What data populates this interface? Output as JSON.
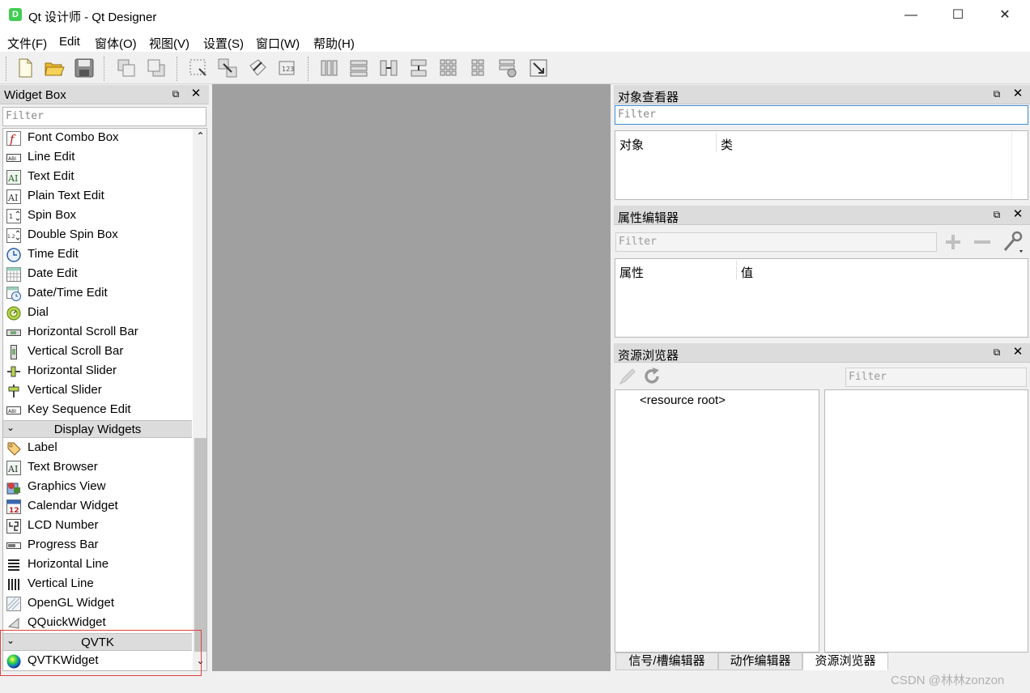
{
  "window": {
    "title": "Qt 设计师 - Qt Designer",
    "app_icon_letter": "D",
    "minimize": "—",
    "maximize": "☐",
    "close": "✕"
  },
  "menu": [
    "文件(F)",
    "Edit",
    "窗体(O)",
    "视图(V)",
    "设置(S)",
    "窗口(W)",
    "帮助(H)"
  ],
  "widget_box": {
    "title": "Widget Box",
    "filter_placeholder": "Filter",
    "items": [
      {
        "label": "Font Combo Box",
        "icon": "font-combo-icon"
      },
      {
        "label": "Line Edit",
        "icon": "line-edit-icon"
      },
      {
        "label": "Text Edit",
        "icon": "text-edit-icon"
      },
      {
        "label": "Plain Text Edit",
        "icon": "plain-text-edit-icon"
      },
      {
        "label": "Spin Box",
        "icon": "spin-box-icon"
      },
      {
        "label": "Double Spin Box",
        "icon": "double-spin-box-icon"
      },
      {
        "label": "Time Edit",
        "icon": "clock-icon"
      },
      {
        "label": "Date Edit",
        "icon": "calendar-grid-icon"
      },
      {
        "label": "Date/Time Edit",
        "icon": "datetime-icon"
      },
      {
        "label": "Dial",
        "icon": "dial-icon"
      },
      {
        "label": "Horizontal Scroll Bar",
        "icon": "hscrollbar-icon"
      },
      {
        "label": "Vertical Scroll Bar",
        "icon": "vscrollbar-icon"
      },
      {
        "label": "Horizontal Slider",
        "icon": "hslider-icon"
      },
      {
        "label": "Vertical Slider",
        "icon": "vslider-icon"
      },
      {
        "label": "Key Sequence Edit",
        "icon": "key-sequence-icon"
      }
    ],
    "category_display": "Display Widgets",
    "display_items": [
      {
        "label": "Label",
        "icon": "label-tag-icon"
      },
      {
        "label": "Text Browser",
        "icon": "text-browser-icon"
      },
      {
        "label": "Graphics View",
        "icon": "graphics-view-icon"
      },
      {
        "label": "Calendar Widget",
        "icon": "calendar-widget-icon"
      },
      {
        "label": "LCD Number",
        "icon": "lcd-number-icon"
      },
      {
        "label": "Progress Bar",
        "icon": "progress-bar-icon"
      },
      {
        "label": "Horizontal Line",
        "icon": "horizontal-line-icon"
      },
      {
        "label": "Vertical Line",
        "icon": "vertical-line-icon"
      },
      {
        "label": "OpenGL Widget",
        "icon": "opengl-icon"
      },
      {
        "label": "QQuickWidget",
        "icon": "qquick-icon"
      }
    ],
    "category_qvtk": "QVTK",
    "qvtk_items": [
      {
        "label": "QVTKWidget",
        "icon": "qvtk-sphere-icon"
      }
    ],
    "text_glyph_AI": "AI",
    "text_glyph_ABI": "ABI",
    "calendar_day": "12",
    "scroll_up": "⌃",
    "scroll_down": "⌄"
  },
  "object_inspector": {
    "title": "对象查看器",
    "filter_placeholder": "Filter",
    "col_object": "对象",
    "col_class": "类"
  },
  "property_editor": {
    "title": "属性编辑器",
    "filter_placeholder": "Filter",
    "col_property": "属性",
    "col_value": "值"
  },
  "resource_browser": {
    "title": "资源浏览器",
    "filter_placeholder": "Filter",
    "root": "<resource root>"
  },
  "bottom_tabs": [
    "信号/槽编辑器",
    "动作编辑器",
    "资源浏览器"
  ],
  "active_tab": "资源浏览器",
  "watermark": "CSDN @林林zonzon",
  "colors": {
    "accent": "#3a8fd9",
    "highlight_border": "#e04040",
    "mdi_background": "#a0a0a0"
  }
}
